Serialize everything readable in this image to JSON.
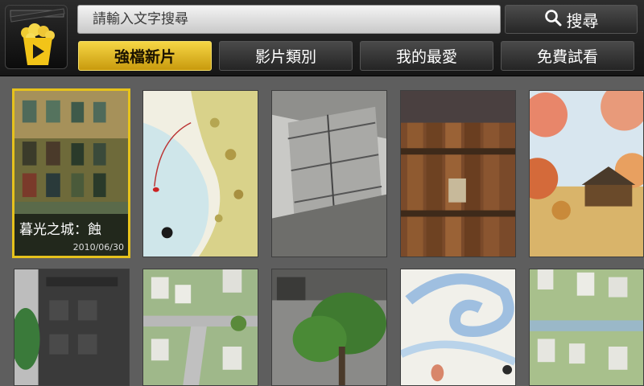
{
  "search": {
    "placeholder": "請輸入文字搜尋",
    "button_label": "搜尋"
  },
  "tabs": [
    {
      "label": "強檔新片",
      "active": true
    },
    {
      "label": "影片類別",
      "active": false
    },
    {
      "label": "我的最愛",
      "active": false
    },
    {
      "label": "免費試看",
      "active": false
    }
  ],
  "movies": [
    {
      "title": "暮光之城：蝕",
      "date": "2010/06/30",
      "selected": true
    },
    {
      "title": "",
      "date": ""
    },
    {
      "title": "",
      "date": ""
    },
    {
      "title": "",
      "date": ""
    },
    {
      "title": "",
      "date": ""
    },
    {
      "title": "",
      "date": ""
    },
    {
      "title": "",
      "date": ""
    },
    {
      "title": "",
      "date": ""
    },
    {
      "title": "",
      "date": ""
    },
    {
      "title": "",
      "date": ""
    }
  ],
  "colors": {
    "accent": "#e6c21c",
    "header_bg": "#1e1e1e",
    "grid_bg": "#5e5e5e"
  },
  "icons": {
    "logo": "popcorn-play-icon",
    "search": "magnifier-icon"
  }
}
